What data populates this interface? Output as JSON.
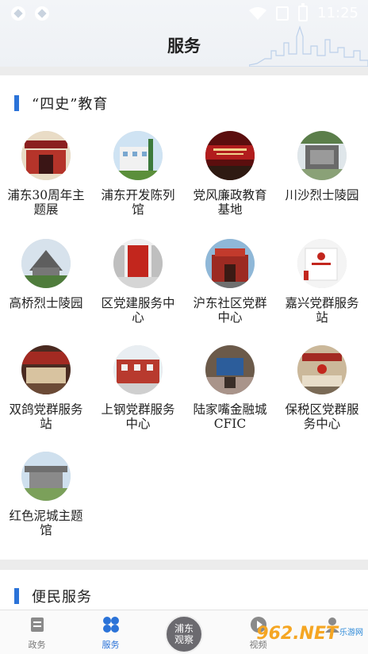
{
  "status": {
    "time": "11:25"
  },
  "header": {
    "title": "服务"
  },
  "section1": {
    "title": "“四史”教育"
  },
  "items": [
    {
      "label": "浦东30周年主题展",
      "icon": "exhibition-icon"
    },
    {
      "label": "浦东开发陈列馆",
      "icon": "museum-icon"
    },
    {
      "label": "党风廉政教育基地",
      "icon": "education-base-icon"
    },
    {
      "label": "川沙烈士陵园",
      "icon": "memorial-icon"
    },
    {
      "label": "高桥烈士陵园",
      "icon": "memorial-icon"
    },
    {
      "label": "区党建服务中心",
      "icon": "service-center-icon"
    },
    {
      "label": "沪东社区党群中心",
      "icon": "community-center-icon"
    },
    {
      "label": "嘉兴党群服务站",
      "icon": "service-station-icon"
    },
    {
      "label": "双鸽党群服务站",
      "icon": "service-station-icon"
    },
    {
      "label": "上钢党群服务中心",
      "icon": "service-center-icon"
    },
    {
      "label": "陆家嘴金融城CFIC",
      "icon": "finance-city-icon"
    },
    {
      "label": "保税区党群服务中心",
      "icon": "service-center-icon"
    },
    {
      "label": "红色泥城主题馆",
      "icon": "theme-hall-icon"
    }
  ],
  "section2": {
    "title": "便民服务"
  },
  "tabs": [
    {
      "label": "政务",
      "icon": "document-icon"
    },
    {
      "label": "服务",
      "icon": "grid-icon",
      "active": true
    },
    {
      "label": "浦东观察",
      "icon": "logo-icon"
    },
    {
      "label": "视频",
      "icon": "play-icon"
    },
    {
      "label": "",
      "icon": "user-icon"
    }
  ],
  "center_badge": {
    "line1": "浦东",
    "line2": "观察"
  },
  "watermark": {
    "num": "962.NET",
    "text": "乐游网"
  },
  "colors": {
    "accent": "#2b73d8",
    "header_bg": "#eef1f5"
  }
}
